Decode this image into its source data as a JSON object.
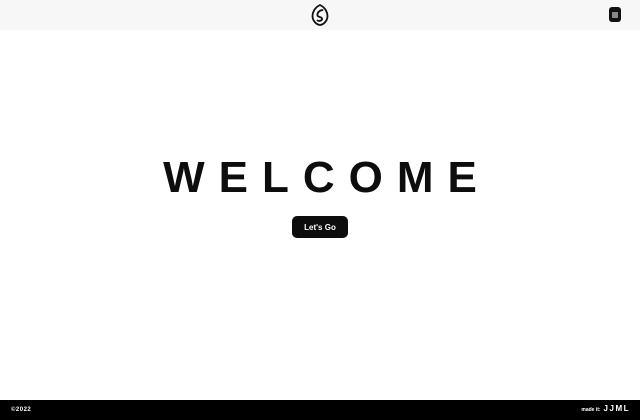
{
  "header": {
    "logo_icon": "leaf-logo-icon",
    "menu_icon": "menu-icon"
  },
  "hero": {
    "title": "WELCOME",
    "cta_label": "Let's Go"
  },
  "footer": {
    "copyright": "©2022",
    "made_by_label": "made it:",
    "made_by_brand": "JJML"
  },
  "colors": {
    "background": "#ffffff",
    "header_background": "#f7f7f7",
    "text": "#0d0d0d",
    "button": "#0d0d0d",
    "footer": "#000000"
  }
}
